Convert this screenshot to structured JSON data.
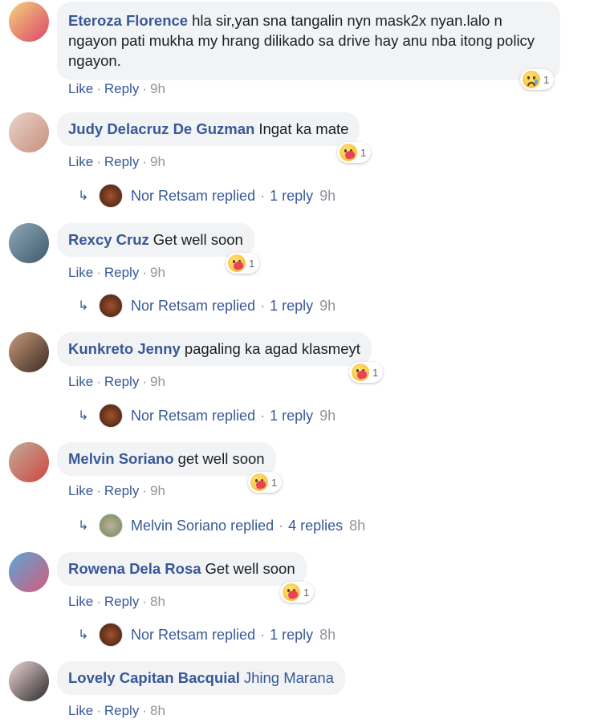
{
  "actions": {
    "like": "Like",
    "reply": "Reply",
    "sep": "·"
  },
  "comments": [
    {
      "author": "Eteroza Florence",
      "text": "hla sir,yan sna tangalin nyn mask2x nyan.lalo n ngayon pati mukha my hrang dilikado sa drive hay anu nba itong policy ngayon.",
      "time": "9h",
      "reaction": {
        "type": "sad",
        "count": "1"
      },
      "avatar_colors": [
        "#f5d47a",
        "#d9456a"
      ]
    },
    {
      "author": "Judy Delacruz De Guzman",
      "text": "Ingat ka mate",
      "time": "9h",
      "reaction": {
        "type": "care",
        "count": "1"
      },
      "avatar_colors": [
        "#e8d4cc",
        "#c88f7c"
      ],
      "reply": {
        "name": "Nor Retsam",
        "verb": "replied",
        "count_text": "1 reply",
        "time": "9h"
      }
    },
    {
      "author": "Rexcy Cruz",
      "text": "Get well soon",
      "time": "9h",
      "reaction": {
        "type": "care",
        "count": "1"
      },
      "avatar_colors": [
        "#8fa8b8",
        "#3e5a6e"
      ],
      "reply": {
        "name": "Nor Retsam",
        "verb": "replied",
        "count_text": "1 reply",
        "time": "9h"
      }
    },
    {
      "author": "Kunkreto Jenny",
      "text": "pagaling ka agad klasmeyt",
      "time": "9h",
      "reaction": {
        "type": "care",
        "count": "1"
      },
      "avatar_colors": [
        "#c99a7a",
        "#3a2a22"
      ],
      "reply": {
        "name": "Nor Retsam",
        "verb": "replied",
        "count_text": "1 reply",
        "time": "9h"
      }
    },
    {
      "author": "Melvin Soriano",
      "text": "get well soon",
      "time": "9h",
      "reaction": {
        "type": "care",
        "count": "1"
      },
      "avatar_colors": [
        "#bfae9a",
        "#d0453e"
      ],
      "reply": {
        "name": "Melvin Soriano",
        "verb": "replied",
        "count_text": "4 replies",
        "time": "8h"
      }
    },
    {
      "author": "Rowena Dela Rosa",
      "text": "Get well soon",
      "time": "8h",
      "reaction": {
        "type": "care",
        "count": "1"
      },
      "avatar_colors": [
        "#5aa7d8",
        "#d45a7a"
      ],
      "reply": {
        "name": "Nor Retsam",
        "verb": "replied",
        "count_text": "1 reply",
        "time": "8h"
      }
    },
    {
      "author": "Lovely Capitan Bacquial",
      "text": "Jhing Marana",
      "time": "8h",
      "avatar_colors": [
        "#f0d6d8",
        "#2a2a2a"
      ]
    }
  ],
  "colors": {
    "link": "#385898",
    "muted": "#90949c",
    "bubble": "#f2f3f5"
  }
}
